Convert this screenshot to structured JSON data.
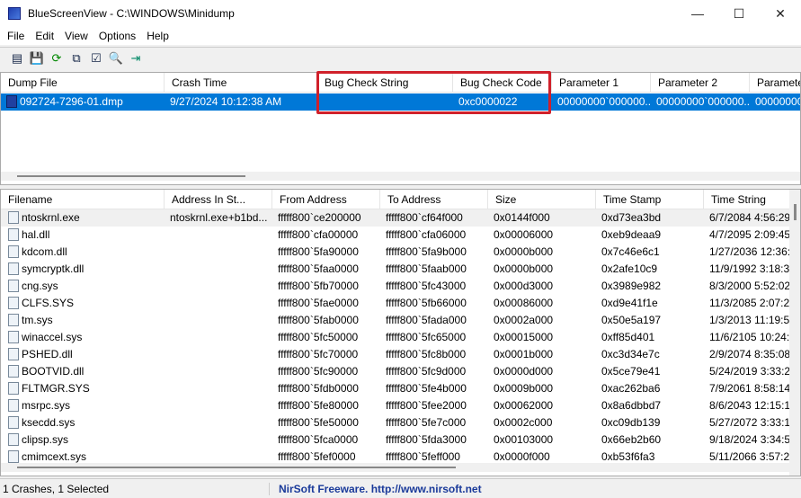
{
  "window": {
    "title": "BlueScreenView  -  C:\\WINDOWS\\Minidump"
  },
  "menu": [
    "File",
    "Edit",
    "View",
    "Options",
    "Help"
  ],
  "toolbar": [
    "html-report-icon",
    "save-icon",
    "refresh-icon",
    "copy-icon",
    "properties-icon",
    "find-icon",
    "exit-icon"
  ],
  "top_table": {
    "columns": [
      "Dump File",
      "Crash Time",
      "Bug Check String",
      "Bug Check Code",
      "Parameter 1",
      "Parameter 2",
      "Paramete"
    ],
    "sort_indicator": "▽",
    "rows": [
      [
        "092724-7296-01.dmp",
        "9/27/2024 10:12:38 AM",
        "",
        "0xc0000022",
        "00000000`000000...",
        "00000000`000000...",
        "00000000`"
      ]
    ]
  },
  "bottom_table": {
    "columns": [
      "Filename",
      "Address In St...",
      "From Address",
      "To Address",
      "Size",
      "Time Stamp",
      "Time String"
    ],
    "rows": [
      [
        "ntoskrnl.exe",
        "ntoskrnl.exe+b1bd...",
        "fffff800`ce200000",
        "fffff800`cf64f000",
        "0x0144f000",
        "0xd73ea3bd",
        "6/7/2084 4:56:29"
      ],
      [
        "hal.dll",
        "",
        "fffff800`cfa00000",
        "fffff800`cfa06000",
        "0x00006000",
        "0xeb9deaa9",
        "4/7/2095 2:09:45"
      ],
      [
        "kdcom.dll",
        "",
        "fffff800`5fa90000",
        "fffff800`5fa9b000",
        "0x0000b000",
        "0x7c46e6c1",
        "1/27/2036 12:36:"
      ],
      [
        "symcryptk.dll",
        "",
        "fffff800`5faa0000",
        "fffff800`5faab000",
        "0x0000b000",
        "0x2afe10c9",
        "11/9/1992 3:18:3"
      ],
      [
        "cng.sys",
        "",
        "fffff800`5fb70000",
        "fffff800`5fc43000",
        "0x000d3000",
        "0x3989e982",
        "8/3/2000 5:52:02"
      ],
      [
        "CLFS.SYS",
        "",
        "fffff800`5fae0000",
        "fffff800`5fb66000",
        "0x00086000",
        "0xd9e41f1e",
        "11/3/2085 2:07:2"
      ],
      [
        "tm.sys",
        "",
        "fffff800`5fab0000",
        "fffff800`5fada000",
        "0x0002a000",
        "0x50e5a197",
        "1/3/2013 11:19:5"
      ],
      [
        "winaccel.sys",
        "",
        "fffff800`5fc50000",
        "fffff800`5fc65000",
        "0x00015000",
        "0xff85d401",
        "11/6/2105 10:24:"
      ],
      [
        "PSHED.dll",
        "",
        "fffff800`5fc70000",
        "fffff800`5fc8b000",
        "0x0001b000",
        "0xc3d34e7c",
        "2/9/2074 8:35:08"
      ],
      [
        "BOOTVID.dll",
        "",
        "fffff800`5fc90000",
        "fffff800`5fc9d000",
        "0x0000d000",
        "0x5ce79e41",
        "5/24/2019 3:33:2"
      ],
      [
        "FLTMGR.SYS",
        "",
        "fffff800`5fdb0000",
        "fffff800`5fe4b000",
        "0x0009b000",
        "0xac262ba6",
        "7/9/2061 8:58:14"
      ],
      [
        "msrpc.sys",
        "",
        "fffff800`5fe80000",
        "fffff800`5fee2000",
        "0x00062000",
        "0x8a6dbbd7",
        "8/6/2043 12:15:1"
      ],
      [
        "ksecdd.sys",
        "",
        "fffff800`5fe50000",
        "fffff800`5fe7c000",
        "0x0002c000",
        "0xc09db139",
        "5/27/2072 3:33:1"
      ],
      [
        "clipsp.sys",
        "",
        "fffff800`5fca0000",
        "fffff800`5fda3000",
        "0x00103000",
        "0x66eb2b60",
        "9/18/2024 3:34:5"
      ],
      [
        "cmimcext.sys",
        "",
        "fffff800`5fef0000",
        "fffff800`5feff000",
        "0x0000f000",
        "0xb53f6fa3",
        "5/11/2066 3:57:2"
      ]
    ]
  },
  "status": {
    "count": "1 Crashes, 1 Selected",
    "credit": "NirSoft Freeware.  http://www.nirsoft.net"
  },
  "colors": {
    "selection": "#0078d7",
    "highlight_box": "#d0202a",
    "credit": "#1a3a9a"
  }
}
